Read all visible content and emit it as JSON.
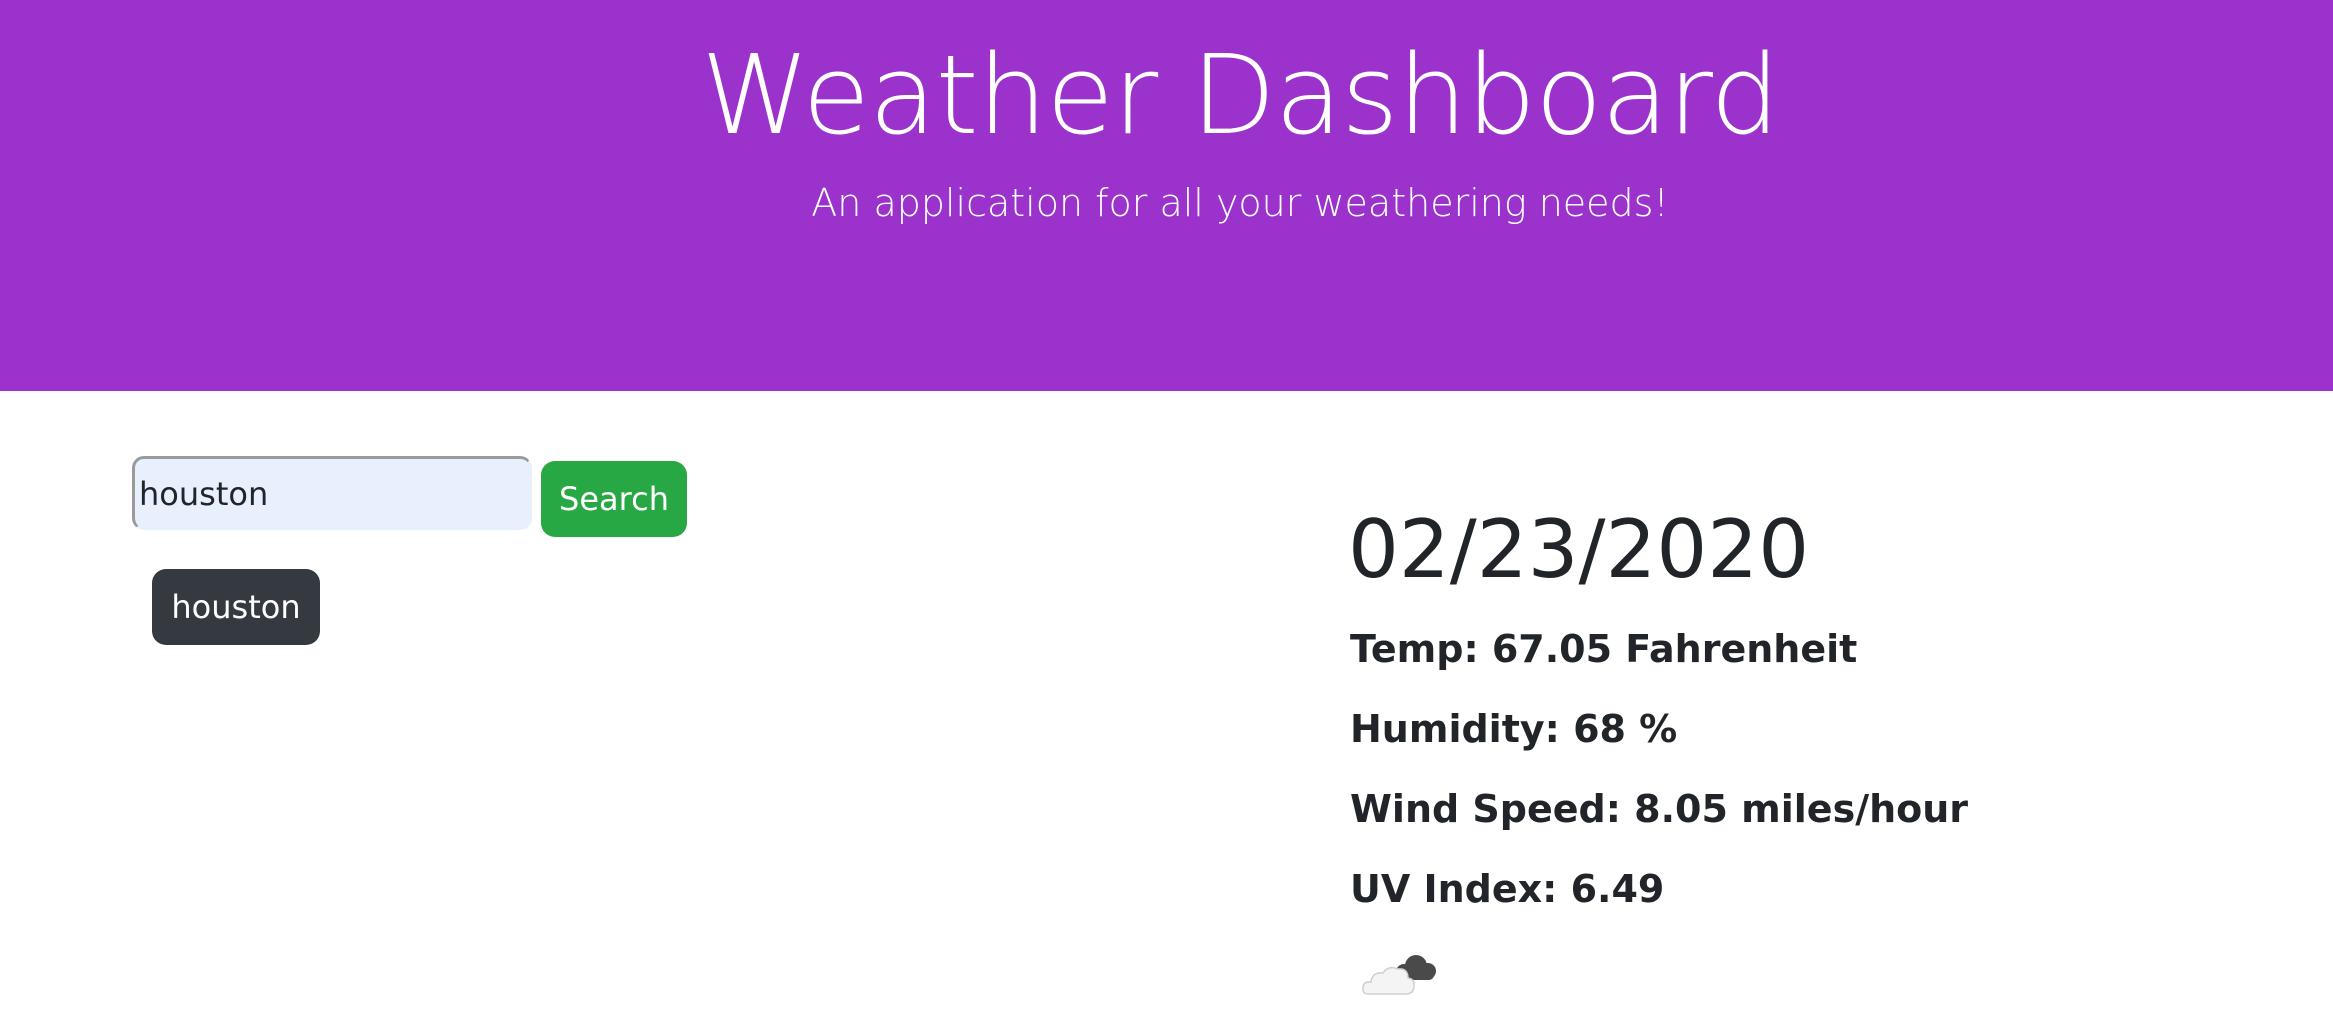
{
  "header": {
    "title": "Weather Dashboard",
    "subtitle": "An application for all your weathering needs!"
  },
  "search": {
    "value": "houston",
    "button_label": "Search"
  },
  "history": {
    "items": [
      {
        "label": "houston"
      }
    ]
  },
  "current": {
    "date": "02/23/2020",
    "temp": "Temp: 67.05 Fahrenheit",
    "humidity": "Humidity: 68 %",
    "wind": "Wind Speed: 8.05 miles/hour",
    "uv": "UV Index: 6.49",
    "icon": "cloudy-icon"
  },
  "colors": {
    "banner": "#9b32cc",
    "search_button": "#28a745",
    "history_button": "#343a40",
    "text": "#212529"
  }
}
